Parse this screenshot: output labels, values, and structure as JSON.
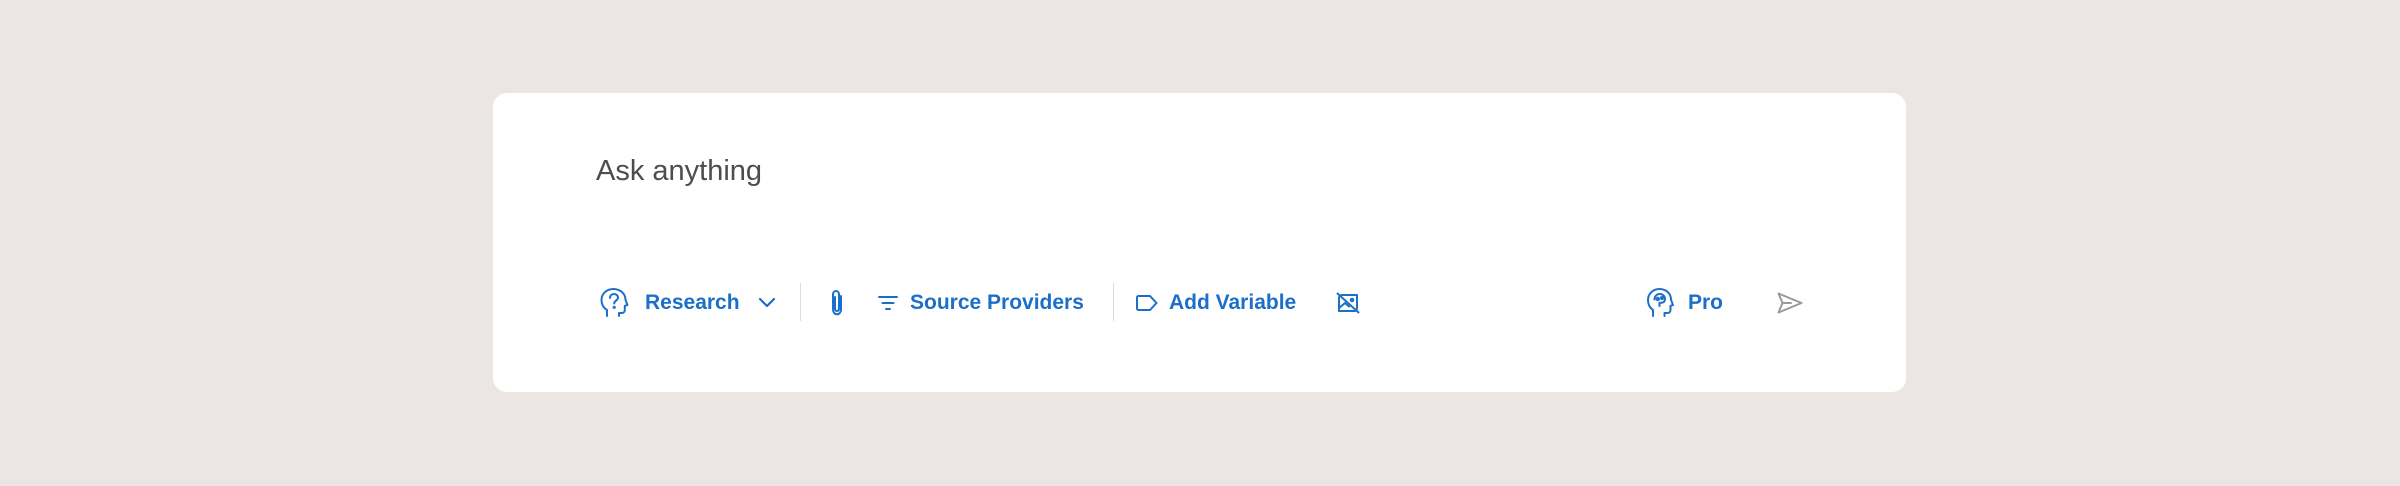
{
  "composer": {
    "placeholder": "Ask anything"
  },
  "toolbar": {
    "mode_label": "Research",
    "sources_label": "Source Providers",
    "variable_label": "Add Variable",
    "model_label": "Pro"
  },
  "icons": {
    "mode": "head-question-icon",
    "mode_dropdown": "chevron-down-icon",
    "attach": "paperclip-icon",
    "sources": "filter-icon",
    "variable": "tag-icon",
    "image_off": "image-off-icon",
    "model": "head-brain-icon",
    "send": "send-icon"
  },
  "colors": {
    "page_background": "#ebe6e3",
    "card_background": "#ffffff",
    "accent": "#1b6fc8",
    "placeholder_text": "#4d4d4d",
    "send_disabled": "#9a9a9a"
  }
}
